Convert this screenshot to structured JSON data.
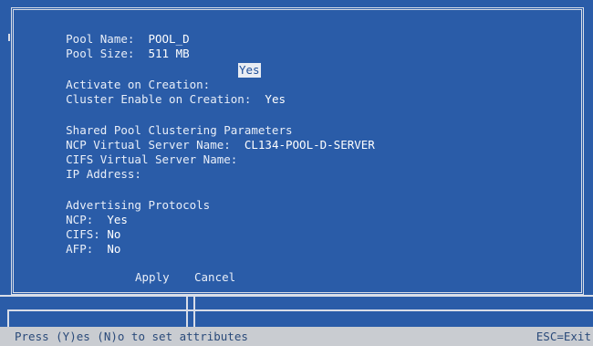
{
  "pool": {
    "name_label": "Pool Name:",
    "name_value": "POOL_D",
    "size_label": "Pool Size:",
    "size_value": "511 MB"
  },
  "options": {
    "activate_label": "Activate on Creation:",
    "activate_value": "Yes",
    "cluster_label": "Cluster Enable on Creation:",
    "cluster_value": "Yes"
  },
  "clustering": {
    "section_title": "Shared Pool Clustering Parameters",
    "ncp_server_label": "NCP Virtual Server Name:",
    "ncp_server_value": "CL134-POOL-D-SERVER",
    "cifs_server_label": "CIFS Virtual Server Name:",
    "cifs_server_value": "",
    "ip_label": "IP Address:",
    "ip_value": ""
  },
  "protocols": {
    "section_title": "Advertising Protocols",
    "ncp_label": "NCP:",
    "ncp_value": "Yes",
    "cifs_label": "CIFS:",
    "cifs_value": "No",
    "afp_label": "AFP:",
    "afp_value": "No"
  },
  "buttons": {
    "apply": "Apply",
    "cancel": "Cancel"
  },
  "status_bar": {
    "hint": "Press (Y)es (N)o to set attributes",
    "exit": "ESC=Exit"
  }
}
